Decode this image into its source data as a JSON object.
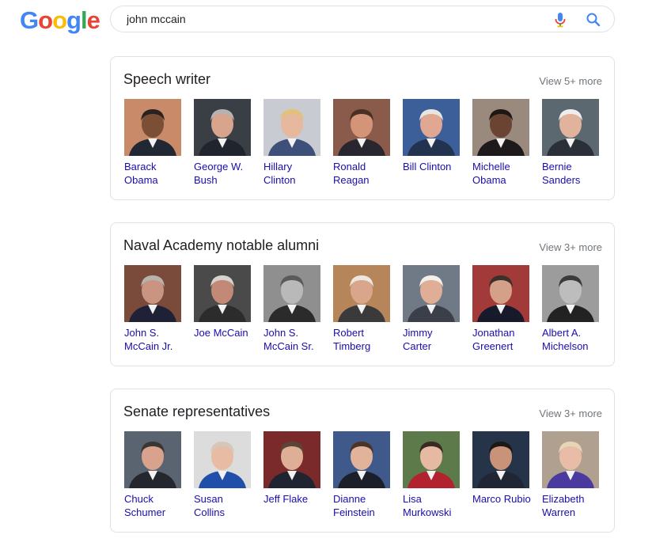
{
  "search": {
    "query": "john mccain"
  },
  "logo": {
    "letters": [
      "G",
      "o",
      "o",
      "g",
      "l",
      "e"
    ],
    "colors": [
      "#4285F4",
      "#EA4335",
      "#FBBC05",
      "#4285F4",
      "#34A853",
      "#EA4335"
    ]
  },
  "icons": {
    "mic": "mic-icon",
    "search": "search-icon"
  },
  "sections": [
    {
      "title": "Speech writer",
      "view_more": "View 5+ more",
      "people": [
        {
          "name": "Barack Obama",
          "bg": "#c98a6a",
          "skin": "#7a4f36",
          "suit": "#222833",
          "hair": "#2a2220"
        },
        {
          "name": "George W. Bush",
          "bg": "#3a3f46",
          "skin": "#d8a58c",
          "suit": "#20252d",
          "hair": "#b7b2ad"
        },
        {
          "name": "Hillary Clinton",
          "bg": "#c8ccd2",
          "skin": "#e6b89e",
          "suit": "#3e4f7a",
          "hair": "#e2c27a"
        },
        {
          "name": "Ronald Reagan",
          "bg": "#8a5a4a",
          "skin": "#d39478",
          "suit": "#2a2630",
          "hair": "#4a2f25"
        },
        {
          "name": "Bill Clinton",
          "bg": "#3c5f9a",
          "skin": "#e0a892",
          "suit": "#23324f",
          "hair": "#e8e6e3"
        },
        {
          "name": "Michelle Obama",
          "bg": "#9a8a7e",
          "skin": "#6b4332",
          "suit": "#1e1a1c",
          "hair": "#1e1716"
        },
        {
          "name": "Bernie Sanders",
          "bg": "#5c6870",
          "skin": "#e1b39d",
          "suit": "#2a2f38",
          "hair": "#eeeeee"
        }
      ]
    },
    {
      "title": "Naval Academy notable alumni",
      "view_more": "View 3+ more",
      "people": [
        {
          "name": "John S. McCain Jr.",
          "bg": "#7a4a3a",
          "skin": "#c99582",
          "suit": "#1f2236",
          "hair": "#b8b2ac"
        },
        {
          "name": "Joe McCain",
          "bg": "#4a4a4a",
          "skin": "#c28a76",
          "suit": "#2c2c2c",
          "hair": "#d6d3cf"
        },
        {
          "name": "John S. McCain Sr.",
          "bg": "#8f8f8f",
          "skin": "#b9b9b9",
          "suit": "#2b2b2b",
          "hair": "#5a5a5a"
        },
        {
          "name": "Robert Timberg",
          "bg": "#b7855a",
          "skin": "#d9a68c",
          "suit": "#3a3a3a",
          "hair": "#ebe6e0"
        },
        {
          "name": "Jimmy Carter",
          "bg": "#6f7a86",
          "skin": "#e0ae96",
          "suit": "#3b3f4a",
          "hair": "#f1efec"
        },
        {
          "name": "Jonathan Greenert",
          "bg": "#a33a3a",
          "skin": "#d4a088",
          "suit": "#161a2a",
          "hair": "#3a302c"
        },
        {
          "name": "Albert A. Michelson",
          "bg": "#9c9c9c",
          "skin": "#bdbdbd",
          "suit": "#222222",
          "hair": "#3a3a3a"
        }
      ]
    },
    {
      "title": "Senate representatives",
      "view_more": "View 3+ more",
      "people": [
        {
          "name": "Chuck Schumer",
          "bg": "#5a6470",
          "skin": "#d9a28c",
          "suit": "#24282e",
          "hair": "#3a3634"
        },
        {
          "name": "Susan Collins",
          "bg": "#dcdcdc",
          "skin": "#e8bba5",
          "suit": "#1f4fa8",
          "hair": "#d4c8b8"
        },
        {
          "name": "Jeff Flake",
          "bg": "#7a2a2a",
          "skin": "#dfae97",
          "suit": "#1f2430",
          "hair": "#5a4636"
        },
        {
          "name": "Dianne Feinstein",
          "bg": "#3f5a8a",
          "skin": "#e2b39b",
          "suit": "#1c1f2a",
          "hair": "#4a3428"
        },
        {
          "name": "Lisa Murkowski",
          "bg": "#5c7a4a",
          "skin": "#e5b9a2",
          "suit": "#b3232f",
          "hair": "#3a2a22"
        },
        {
          "name": "Marco Rubio",
          "bg": "#26344a",
          "skin": "#c9937a",
          "suit": "#202634",
          "hair": "#1c1816"
        },
        {
          "name": "Elizabeth Warren",
          "bg": "#b0a090",
          "skin": "#e8bca6",
          "suit": "#4a3aa0",
          "hair": "#e6d6b6"
        }
      ]
    }
  ]
}
